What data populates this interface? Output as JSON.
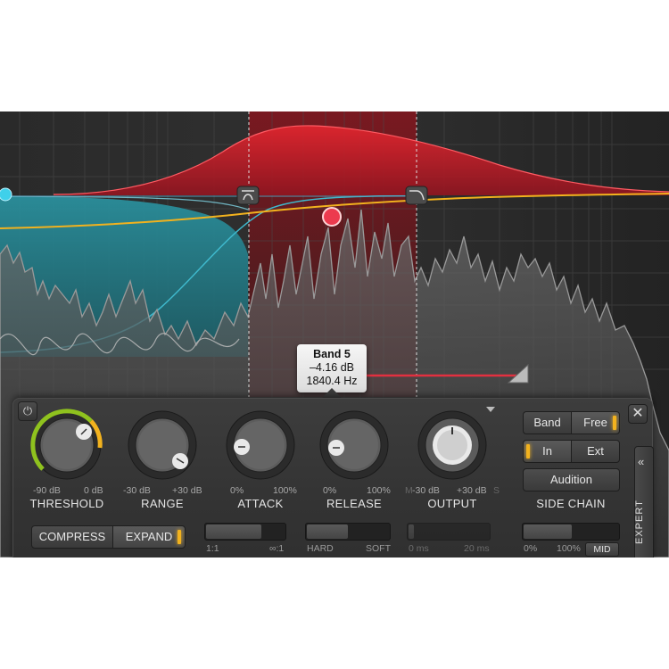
{
  "colors": {
    "background": "#262626",
    "band_highlight": "#7a1a22",
    "expand_curve": "#d0202c",
    "lowband_fill": "#2f8a96",
    "sidechain_curve": "#f2b21e",
    "accent_led": "#f2b21e",
    "node_left": "#3fd0ea",
    "node_selected": "#ec3a4e",
    "knob_arc_threshold": "#8fc21e"
  },
  "tooltip": {
    "band": "Band 5",
    "gain": "–4.16 dB",
    "freq": "1840.4 Hz"
  },
  "controls": {
    "threshold": {
      "label": "THRESHOLD",
      "min": "-90 dB",
      "max": "0 dB"
    },
    "range": {
      "label": "RANGE",
      "min": "-30 dB",
      "max": "+30 dB"
    },
    "attack": {
      "label": "ATTACK",
      "min": "0%",
      "max": "100%"
    },
    "release": {
      "label": "RELEASE",
      "min": "0%",
      "max": "100%"
    },
    "output": {
      "label": "OUTPUT",
      "min_prefix": "M",
      "min": "-30 dB",
      "max": "+30 dB",
      "max_suffix": "S"
    }
  },
  "mode": {
    "compress": "COMPRESS",
    "expand": "EXPAND",
    "active": "expand"
  },
  "sliders": {
    "ratio": {
      "min": "1:1",
      "max": "∞:1"
    },
    "knee": {
      "min": "HARD",
      "max": "SOFT"
    },
    "lookahead": {
      "min": "0 ms",
      "max": "20 ms"
    },
    "sidechain_mix": {
      "min": "0%",
      "max": "100%",
      "mid_button": "MID"
    }
  },
  "sidechain": {
    "band": "Band",
    "free": "Free",
    "in": "In",
    "ext": "Ext",
    "audition": "Audition",
    "label": "SIDE CHAIN"
  },
  "expert": {
    "label": "EXPERT",
    "chevron": "«"
  },
  "icons": {
    "power": "⏻",
    "close": "✕"
  }
}
